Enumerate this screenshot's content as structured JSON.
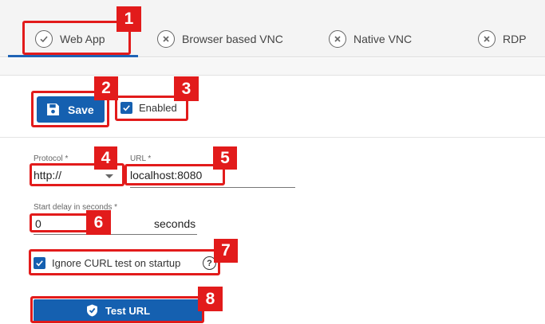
{
  "tabs": [
    {
      "label": "Web App",
      "icon": "check-circle-icon",
      "active": true
    },
    {
      "label": "Browser based VNC",
      "icon": "x-circle-icon",
      "active": false
    },
    {
      "label": "Native VNC",
      "icon": "x-circle-icon",
      "active": false
    },
    {
      "label": "RDP",
      "icon": "x-circle-icon",
      "active": false
    }
  ],
  "toolbar": {
    "save_label": "Save",
    "enabled_label": "Enabled",
    "enabled_checked": true
  },
  "form": {
    "protocol_label": "Protocol *",
    "protocol_value": "http://",
    "url_label": "URL *",
    "url_value": "localhost:8080",
    "delay_label": "Start delay in seconds *",
    "delay_value": "0",
    "delay_unit": "seconds",
    "ignore_curl_label": "Ignore CURL test on startup",
    "ignore_curl_checked": true,
    "help_glyph": "?",
    "test_url_label": "Test URL"
  },
  "callouts": [
    "1",
    "2",
    "3",
    "4",
    "5",
    "6",
    "7",
    "8"
  ],
  "colors": {
    "accent": "#1560b0",
    "callout": "#e21b1b"
  }
}
